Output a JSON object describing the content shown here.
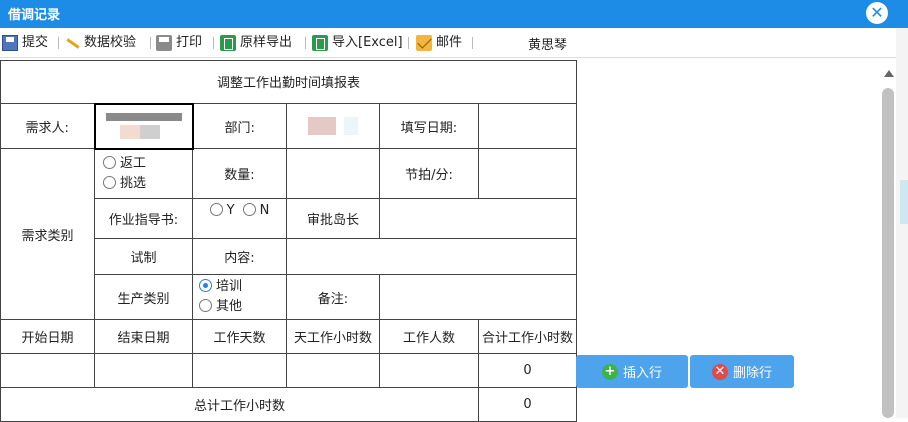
{
  "window": {
    "title": "借调记录"
  },
  "toolbar": {
    "submit": "提交",
    "validate": "数据校验",
    "print": "打印",
    "export_original": "原样导出",
    "import_excel": "导入[Excel]",
    "mail": "邮件",
    "user": "黄思琴"
  },
  "form": {
    "title": "调整工作出勤时间填报表",
    "requester_label": "需求人:",
    "dept_label": "部门:",
    "fill_date_label": "填写日期:",
    "demand_type_label": "需求类别",
    "rework": "返工",
    "pick": "挑选",
    "quantity_label": "数量:",
    "takt_label": "节拍/分:",
    "work_guide_label": "作业指导书:",
    "yes": "Y",
    "no": "N",
    "approver_label": "审批岛长",
    "trial_label": "试制",
    "content_label": "内容:",
    "prod_type_label": "生产类别",
    "training": "培训",
    "other": "其他",
    "remark_label": "备注:",
    "columns": [
      "开始日期",
      "结束日期",
      "工作天数",
      "天工作小时数",
      "工作人数",
      "合计工作小时数"
    ],
    "row_total": "0",
    "grand_total_label": "总计工作小时数",
    "grand_total": "0"
  },
  "buttons": {
    "insert_row": "插入行",
    "delete_row": "删除行"
  },
  "colors": {
    "titlebar": "#1c8ce6",
    "button": "#4da3ec",
    "add_icon": "#3cb44a",
    "delete_icon": "#e24a4a"
  }
}
